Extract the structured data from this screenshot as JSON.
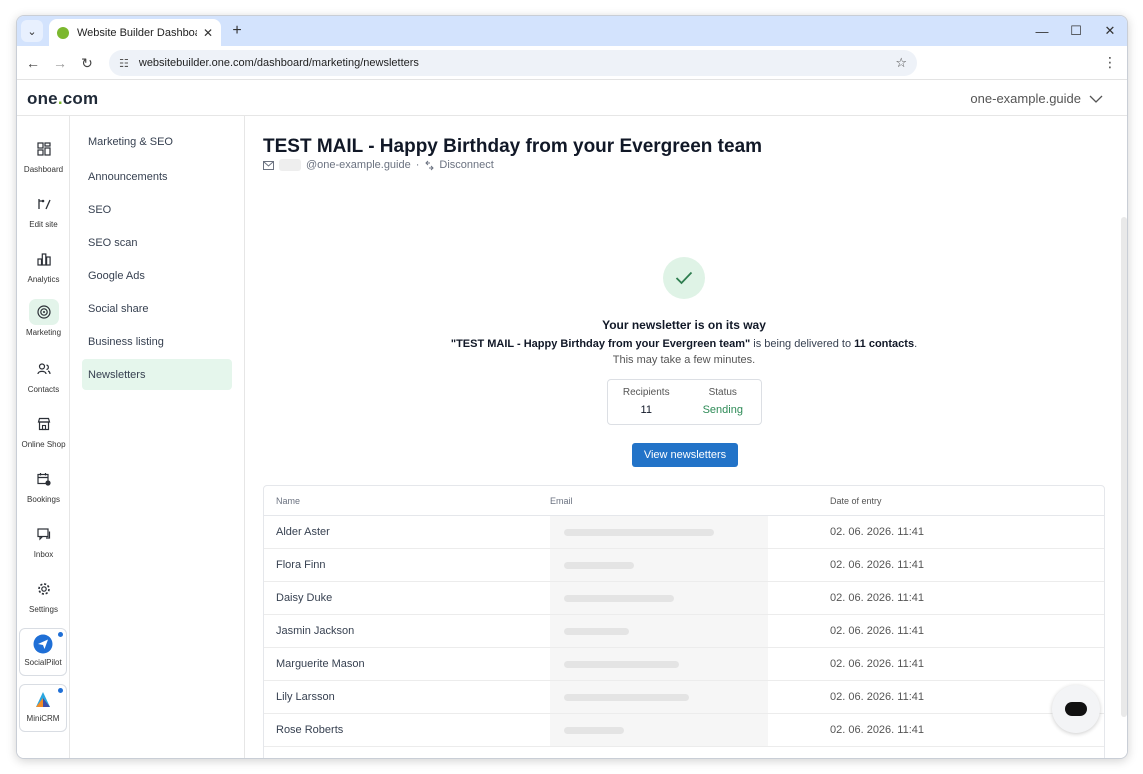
{
  "browser": {
    "tab_title": "Website Builder Dashboard",
    "url": "websitebuilder.one.com/dashboard/marketing/newsletters"
  },
  "header": {
    "logo_text": "one",
    "logo_dot": ".",
    "logo_suffix": "com",
    "account": "one-example.guide"
  },
  "rail": {
    "items": [
      {
        "label": "Dashboard",
        "icon": "dashboard-icon"
      },
      {
        "label": "Edit site",
        "icon": "edit-site-icon"
      },
      {
        "label": "Analytics",
        "icon": "analytics-icon"
      },
      {
        "label": "Marketing",
        "icon": "marketing-icon"
      },
      {
        "label": "Contacts",
        "icon": "contacts-icon"
      },
      {
        "label": "Online Shop",
        "icon": "shop-icon"
      },
      {
        "label": "Bookings",
        "icon": "bookings-icon"
      },
      {
        "label": "Inbox",
        "icon": "inbox-icon"
      },
      {
        "label": "Settings",
        "icon": "settings-icon"
      }
    ],
    "apps": [
      {
        "label": "SocialPilot",
        "icon": "socialpilot-icon"
      },
      {
        "label": "MiniCRM",
        "icon": "minicrm-icon"
      }
    ]
  },
  "subnav": {
    "heading": "Marketing & SEO",
    "items": [
      "Announcements",
      "SEO",
      "SEO scan",
      "Google Ads",
      "Social share",
      "Business listing",
      "Newsletters"
    ]
  },
  "main": {
    "title": "TEST MAIL - Happy Birthday from your Evergreen team",
    "sender_domain": "@one-example.guide",
    "separator": "·",
    "disconnect": "Disconnect",
    "success_title": "Your newsletter is on its way",
    "delivery_quote": "\"TEST MAIL - Happy Birthday from your Evergreen team\"",
    "delivery_middle": " is being delivered to ",
    "delivery_count": "11 contacts",
    "delivery_end": ".",
    "delay_note": "This may take a few minutes.",
    "stats": {
      "recipients_label": "Recipients",
      "recipients_value": "11",
      "status_label": "Status",
      "status_value": "Sending"
    },
    "cta": "View newsletters"
  },
  "table": {
    "headers": [
      "Name",
      "Email",
      "Date of entry"
    ],
    "rows": [
      {
        "name": "Alder Aster",
        "date": "02. 06. 2026. 11:41"
      },
      {
        "name": "Flora Finn",
        "date": "02. 06. 2026. 11:41"
      },
      {
        "name": "Daisy Duke",
        "date": "02. 06. 2026. 11:41"
      },
      {
        "name": "Jasmin Jackson",
        "date": "02. 06. 2026. 11:41"
      },
      {
        "name": "Marguerite Mason",
        "date": "02. 06. 2026. 11:41"
      },
      {
        "name": "Lily Larsson",
        "date": "02. 06. 2026. 11:41"
      },
      {
        "name": "Rose Roberts",
        "date": "02. 06. 2026. 11:41"
      }
    ]
  },
  "colors": {
    "accent": "#2273c8",
    "success": "#2e8b57",
    "active_bg": "#e5f6ec",
    "brand_dot": "#7cb82f"
  }
}
